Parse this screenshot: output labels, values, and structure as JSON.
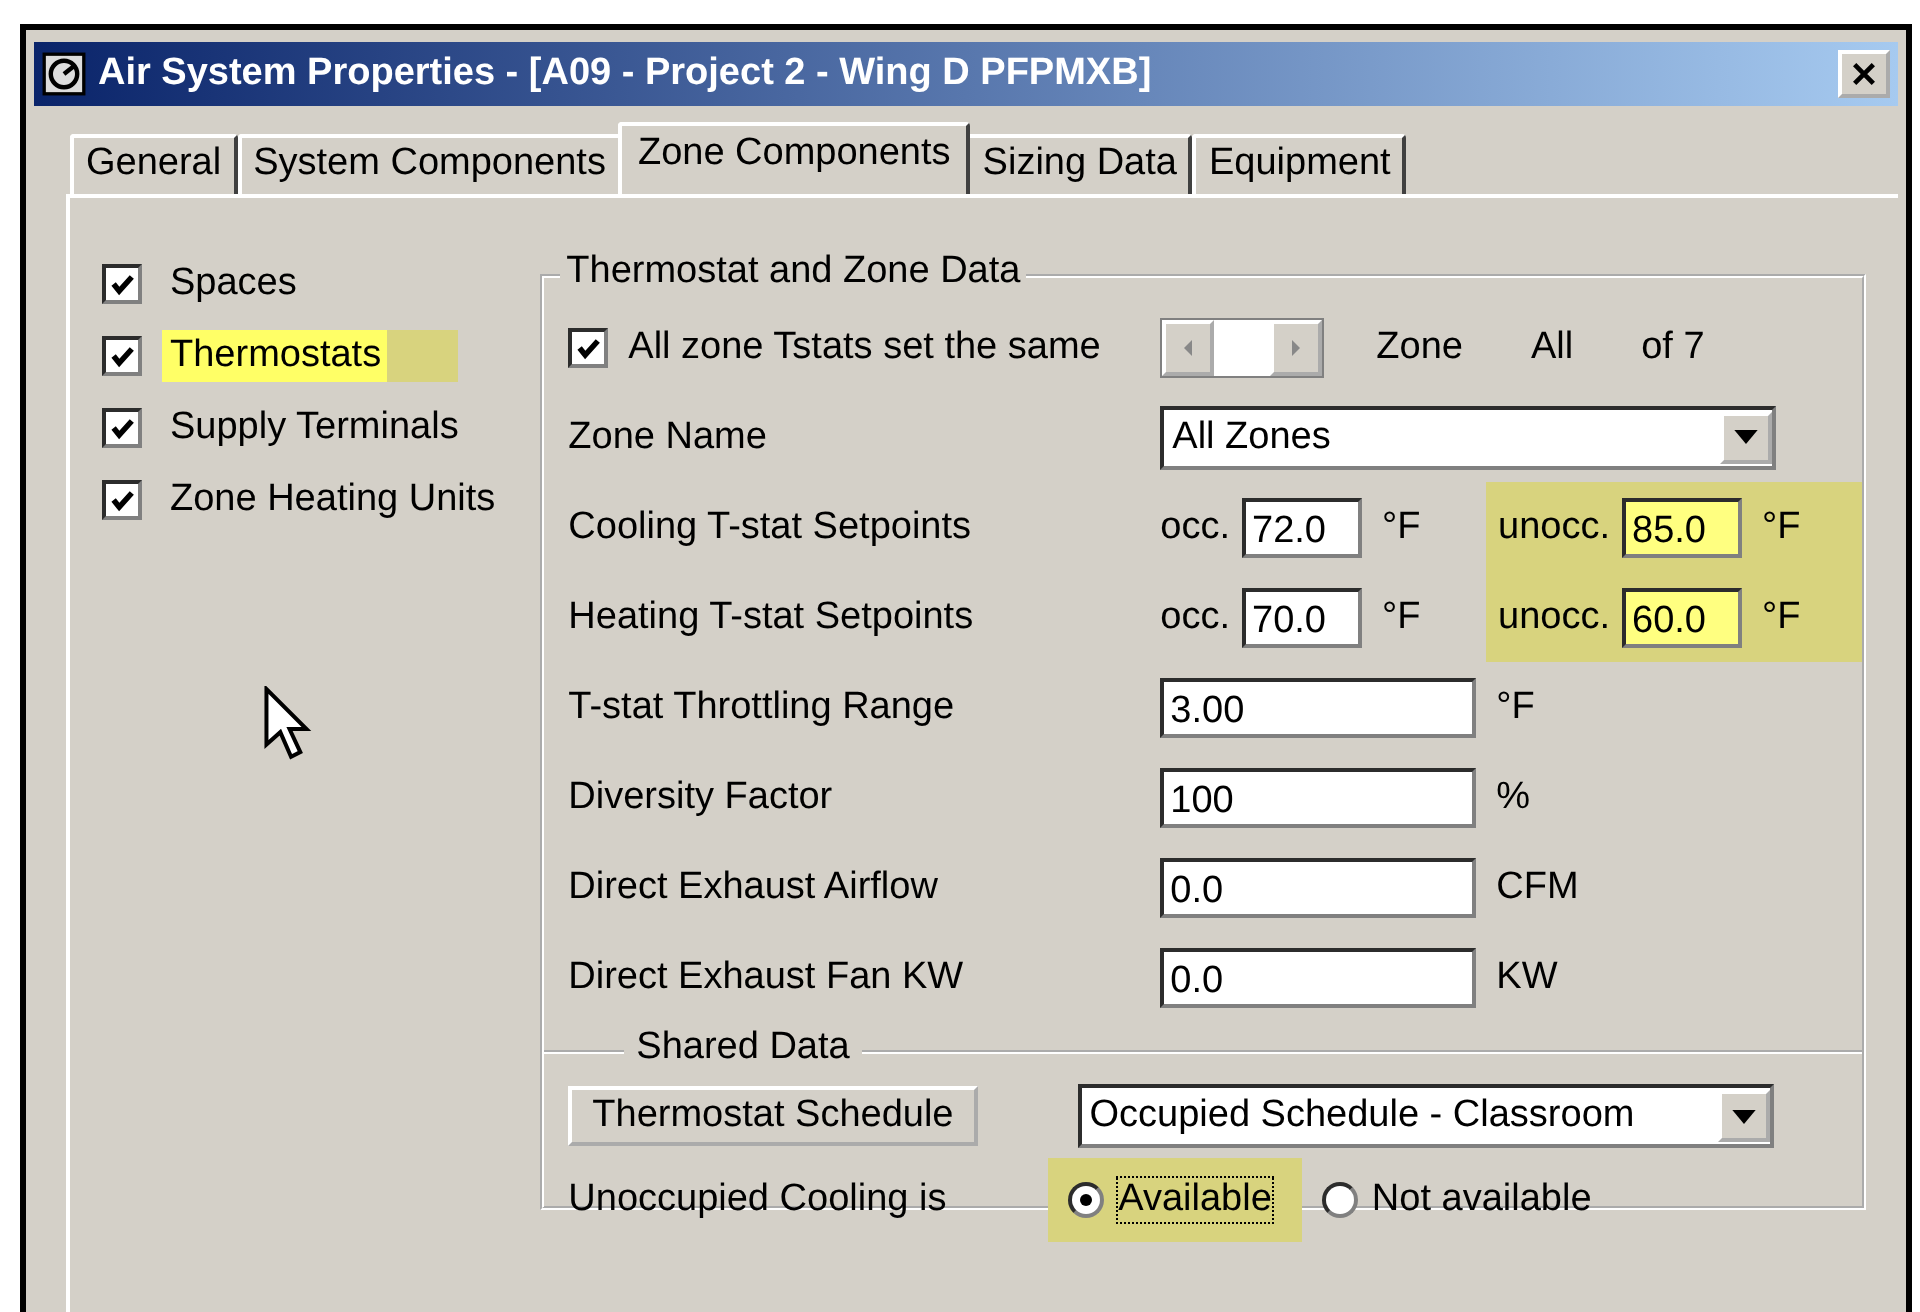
{
  "window": {
    "title": "Air System Properties - [A09 - Project 2 - Wing D PFPMXB]"
  },
  "tabs": [
    {
      "label": "General",
      "selected": false
    },
    {
      "label": "System Components",
      "selected": false
    },
    {
      "label": "Zone Components",
      "selected": true
    },
    {
      "label": "Sizing Data",
      "selected": false
    },
    {
      "label": "Equipment",
      "selected": false
    }
  ],
  "components": [
    {
      "label": "Spaces",
      "checked": true,
      "highlighted": false
    },
    {
      "label": "Thermostats",
      "checked": true,
      "highlighted": true
    },
    {
      "label": "Supply Terminals",
      "checked": true,
      "highlighted": false
    },
    {
      "label": "Zone Heating Units",
      "checked": true,
      "highlighted": false
    }
  ],
  "zone_data": {
    "title": "Thermostat and Zone Data",
    "same_checkbox": {
      "label": "All zone Tstats set the same",
      "checked": true
    },
    "zone_label": "Zone",
    "zone_value": "All",
    "zone_count": "of 7",
    "zone_name": {
      "label": "Zone Name",
      "value": "All Zones"
    },
    "setpoints": [
      {
        "label": "Cooling T-stat Setpoints",
        "occ_label": "occ.",
        "occ": "72.0",
        "occ_unit": "°F",
        "unocc_label": "unocc.",
        "unocc": "85.0",
        "unocc_unit": "°F",
        "highlighted": true
      },
      {
        "label": "Heating T-stat Setpoints",
        "occ_label": "occ.",
        "occ": "70.0",
        "occ_unit": "°F",
        "unocc_label": "unocc.",
        "unocc": "60.0",
        "unocc_unit": "°F",
        "highlighted": true
      }
    ],
    "fields": [
      {
        "label": "T-stat Throttling Range",
        "value": "3.00",
        "unit": "°F"
      },
      {
        "label": "Diversity Factor",
        "value": "100",
        "unit": "%"
      },
      {
        "label": "Direct Exhaust Airflow",
        "value": "0.0",
        "unit": "CFM"
      },
      {
        "label": "Direct Exhaust Fan KW",
        "value": "0.0",
        "unit": "KW"
      }
    ]
  },
  "shared_data": {
    "title": "Shared Data",
    "schedule_button": "Thermostat Schedule",
    "schedule": "Occupied Schedule -  Classroom",
    "cooling_label": "Unoccupied Cooling is",
    "options": [
      {
        "label": "Available",
        "selected": true,
        "highlighted": true
      },
      {
        "label": "Not available",
        "selected": false,
        "highlighted": false
      }
    ]
  }
}
